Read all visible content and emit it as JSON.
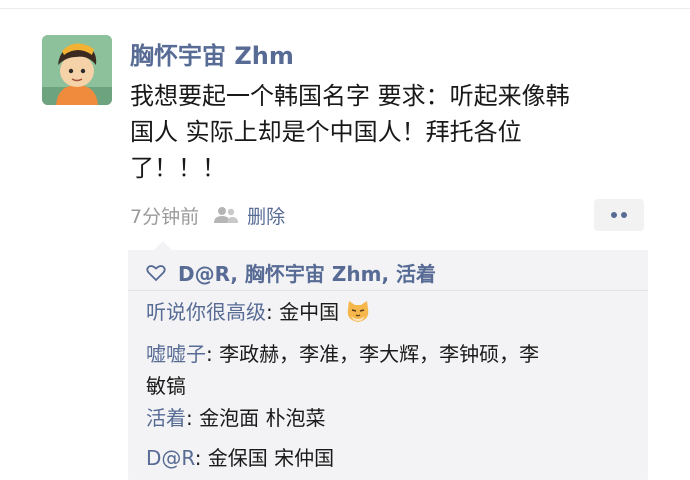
{
  "post": {
    "author": "胸怀宇宙 Zhm",
    "content_lines": [
      "我想要起一个韩国名字 要求：听起来像韩",
      "国人 实际上却是个中国人！拜托各位",
      "了！！！"
    ],
    "time": "7分钟前",
    "delete_label": "删除",
    "more_label": "••"
  },
  "likes": {
    "names": "D@R, 胸怀宇宙 Zhm, 活着"
  },
  "comments": [
    {
      "name": "听说你很高级",
      "sep": ": ",
      "lines": [
        "金中国"
      ],
      "emoji": "cat-emoji"
    },
    {
      "name": "嘘嘘子",
      "sep": ": ",
      "lines": [
        "李政赫，李准，李大辉，李钟硕，李",
        "敏镐"
      ]
    },
    {
      "name": "活着",
      "sep": ": ",
      "lines": [
        "金泡面 朴泡菜"
      ]
    },
    {
      "name": "D@R",
      "sep": ": ",
      "lines": [
        "金保国 宋仲国"
      ]
    }
  ],
  "colors": {
    "link": "#576b95",
    "text": "#191919",
    "meta": "#9a9a9a",
    "comment_bg": "#f3f3f5"
  }
}
